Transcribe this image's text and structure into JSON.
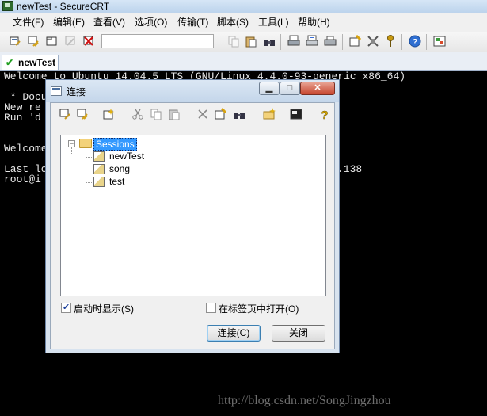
{
  "window": {
    "title": "newTest - SecureCRT"
  },
  "menu": [
    "文件(F)",
    "编辑(E)",
    "查看(V)",
    "选项(O)",
    "传输(T)",
    "脚本(S)",
    "工具(L)",
    "帮助(H)"
  ],
  "toolbar": {
    "icons": [
      "connect-icon",
      "quick-connect-icon",
      "connect-in-tab-icon",
      "reconnect-icon",
      "disconnect-icon",
      "copy-icon",
      "paste-icon",
      "find-icon",
      "print-icon",
      "print-selection-icon",
      "printer-icon",
      "session-options-icon",
      "global-options-icon",
      "keymap-icon",
      "help-icon",
      "map-icon"
    ]
  },
  "tab": {
    "label": "newTest"
  },
  "terminal": {
    "lines": [
      "Welcome to Ubuntu 14.04.5 LTS (GNU/Linux 4.4.0-93-generic x86_64)",
      "",
      " * Docu",
      "New re",
      "Run 'd",
      "",
      "",
      "Welcome",
      "",
      "Last lo",
      "root@i"
    ],
    "ip_fragment": ".138"
  },
  "dialog": {
    "title": "连接",
    "tree": {
      "root": "Sessions",
      "children": [
        "newTest",
        "song",
        "test"
      ]
    },
    "show_on_startup": {
      "label": "启动时显示(S)",
      "checked": true
    },
    "open_in_tab": {
      "label": "在标签页中打开(O)",
      "checked": false
    },
    "connect_button": "连接(C)",
    "close_button": "关闭"
  },
  "watermark": "http://blog.csdn.net/SongJingzhou"
}
